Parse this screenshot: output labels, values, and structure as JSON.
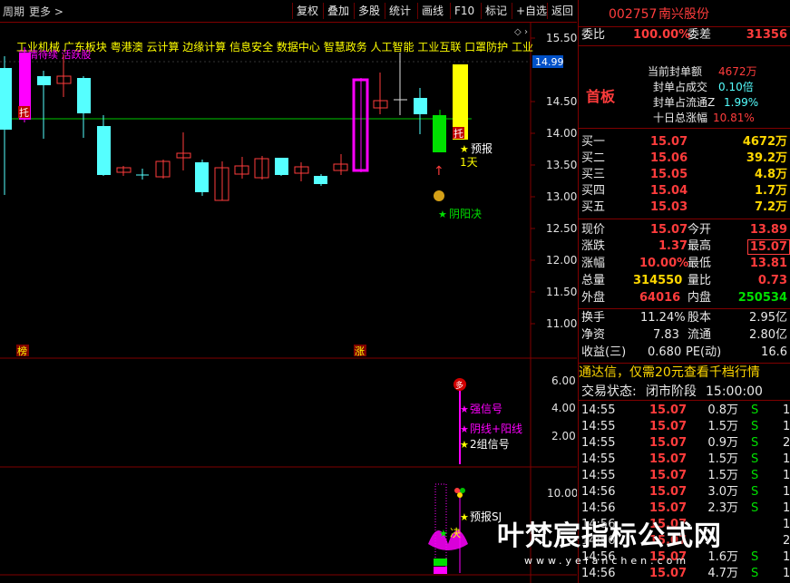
{
  "toolbar": {
    "left": [
      "周期",
      "更多 >"
    ],
    "buttons": [
      "复权",
      "叠加",
      "多股",
      "统计",
      "画线",
      "F10",
      "标记",
      "+自选",
      "返回"
    ]
  },
  "concepts": "工业机械 广东板块 粤港澳 云计算 边缘计算 信息安全 数据中心 智慧政务 人工智能 工业互联 口罩防护 工业",
  "overlay_label": "前情待续 活跃股",
  "price_axis": [
    "15.50",
    "15.00",
    "14.50",
    "14.00",
    "13.50",
    "13.00",
    "12.50",
    "12.00",
    "11.50",
    "11.00"
  ],
  "price_current_tag": "14.99",
  "chart_labels": {
    "tuo1": "托",
    "tuo2": "托",
    "yubao": "预报",
    "day": "1天",
    "yinyangjue": "阴阳决",
    "bang": "榜",
    "zhang": "涨"
  },
  "ind1": {
    "axis": [
      "6.00",
      "4.00",
      "2.00"
    ],
    "badge": "多",
    "signals": [
      "强信号",
      "阴线+阳线",
      "2组信号"
    ]
  },
  "ind2": {
    "axis": [
      "10.00"
    ],
    "signals": [
      "预报SJ",
      "决"
    ]
  },
  "stock": {
    "code": "002757",
    "name": "南兴股份"
  },
  "weibi": {
    "label1": "委比",
    "value1": "100.00%",
    "label2": "委差",
    "value2": "31356"
  },
  "shouban": {
    "title": "首板",
    "items": [
      {
        "label": "当前封单额",
        "value": "4672万"
      },
      {
        "label": "封单占成交",
        "value": "0.10倍"
      },
      {
        "label": "封单占流通Z",
        "value": "1.99%"
      },
      {
        "label": "十日总涨幅",
        "value": "10.81%"
      }
    ]
  },
  "bids": [
    {
      "label": "买一",
      "price": "15.07",
      "vol": "4672万"
    },
    {
      "label": "买二",
      "price": "15.06",
      "vol": "39.2万"
    },
    {
      "label": "买三",
      "price": "15.05",
      "vol": "4.8万"
    },
    {
      "label": "买四",
      "price": "15.04",
      "vol": "1.7万"
    },
    {
      "label": "买五",
      "price": "15.03",
      "vol": "7.2万"
    }
  ],
  "quote": [
    {
      "l1": "现价",
      "v1": "15.07",
      "l2": "今开",
      "v2": "13.89",
      "c1": "red",
      "c2": "red"
    },
    {
      "l1": "涨跌",
      "v1": "1.37",
      "l2": "最高",
      "v2": "15.07",
      "c1": "red",
      "c2": "red"
    },
    {
      "l1": "涨幅",
      "v1": "10.00%",
      "l2": "最低",
      "v2": "13.81",
      "c1": "red",
      "c2": "red"
    },
    {
      "l1": "总量",
      "v1": "314550",
      "l2": "量比",
      "v2": "0.73",
      "c1": "yellow",
      "c2": "red"
    },
    {
      "l1": "外盘",
      "v1": "64016",
      "l2": "内盘",
      "v2": "250534",
      "c1": "red",
      "c2": "green"
    }
  ],
  "fin": [
    {
      "l1": "换手",
      "v1": "11.24%",
      "l2": "股本",
      "v2": "2.95亿"
    },
    {
      "l1": "净资",
      "v1": "7.83",
      "l2": "流通",
      "v2": "2.80亿"
    },
    {
      "l1": "收益(三)",
      "v1": "0.680",
      "l2": "PE(动)",
      "v2": "16.6"
    }
  ],
  "ad_text": "通达信，仅需20元查看千档行情",
  "status": {
    "label": "交易状态:",
    "value": "闭市阶段",
    "time": "15:00:00"
  },
  "ticks": [
    {
      "time": "14:55",
      "price": "15.07",
      "vol": "0.8万",
      "bs": "S",
      "n": "1"
    },
    {
      "time": "14:55",
      "price": "15.07",
      "vol": "1.5万",
      "bs": "S",
      "n": "1"
    },
    {
      "time": "14:55",
      "price": "15.07",
      "vol": "0.9万",
      "bs": "S",
      "n": "2"
    },
    {
      "time": "14:55",
      "price": "15.07",
      "vol": "1.5万",
      "bs": "S",
      "n": "1"
    },
    {
      "time": "14:55",
      "price": "15.07",
      "vol": "1.5万",
      "bs": "S",
      "n": "1"
    },
    {
      "time": "14:56",
      "price": "15.07",
      "vol": "3.0万",
      "bs": "S",
      "n": "1"
    },
    {
      "time": "14:56",
      "price": "15.07",
      "vol": "2.3万",
      "bs": "S",
      "n": "1"
    },
    {
      "time": "14:56",
      "price": "15.07",
      "vol": "",
      "bs": "",
      "n": "1"
    },
    {
      "time": "14:56",
      "price": "15.07",
      "vol": "",
      "bs": "",
      "n": "2"
    },
    {
      "time": "14:56",
      "price": "15.07",
      "vol": "1.6万",
      "bs": "S",
      "n": "1"
    },
    {
      "time": "14:56",
      "price": "15.07",
      "vol": "4.7万",
      "bs": "S",
      "n": "1"
    }
  ],
  "watermark": {
    "title": "叶梵宸指标公式网",
    "url": "www.yefanchen.com"
  },
  "colors": {
    "red": "#ff3c3c",
    "cyan": "#5ff",
    "magenta": "#ff00ff",
    "yellow": "#ffff00",
    "green": "#00e000",
    "frame": "#800000"
  }
}
